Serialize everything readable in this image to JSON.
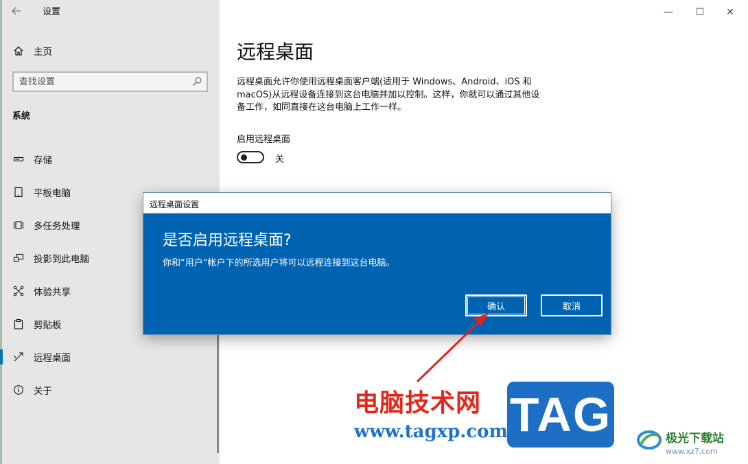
{
  "window": {
    "app_title": "设置",
    "controls": {
      "minimize": "—",
      "maximize": "☐",
      "close": "✕"
    }
  },
  "sidebar": {
    "home_label": "主页",
    "search_placeholder": "查找设置",
    "section_title": "系统",
    "items": [
      {
        "label": "存储",
        "icon": "storage-icon"
      },
      {
        "label": "平板电脑",
        "icon": "tablet-icon"
      },
      {
        "label": "多任务处理",
        "icon": "multitasking-icon"
      },
      {
        "label": "投影到此电脑",
        "icon": "project-icon"
      },
      {
        "label": "体验共享",
        "icon": "share-icon"
      },
      {
        "label": "剪贴板",
        "icon": "clipboard-icon"
      },
      {
        "label": "远程桌面",
        "icon": "remote-desktop-icon",
        "active": true
      },
      {
        "label": "关于",
        "icon": "info-icon"
      }
    ]
  },
  "main": {
    "title": "远程桌面",
    "description": "远程桌面允许你使用远程桌面客户端(适用于 Windows、Android、iOS 和 macOS)从远程设备连接到这台电脑并加以控制。这样，你就可以通过其他设备工作，如同直接在这台电脑上工作一样。",
    "enable_label": "启用远程桌面",
    "toggle_state": "关",
    "toggle_on": false
  },
  "dialog": {
    "title": "远程桌面设置",
    "heading": "是否启用远程桌面?",
    "message": "你和“用户”帐户下的所选用户将可以远程连接到这台电脑。",
    "confirm_label": "确认",
    "cancel_label": "取消"
  },
  "watermark": {
    "site_name": "电脑技术网",
    "site_url": "www.tagxp.com",
    "badge": "TAG",
    "site2_name": "极光下载站",
    "site2_url": "www.xz7.com"
  },
  "colors": {
    "accent": "#0078d7",
    "dialog_bg": "#0063b1",
    "arrow": "#e0241b",
    "sidebar_bg": "#e6e6e6"
  }
}
